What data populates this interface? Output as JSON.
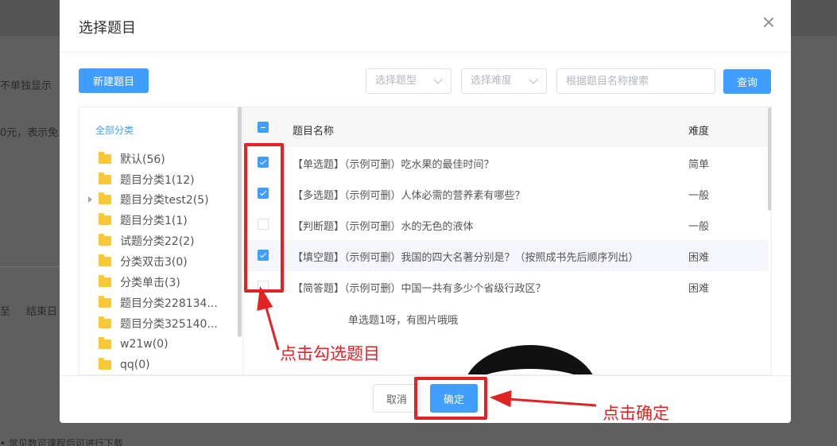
{
  "background": {
    "text_1": "不单独显示",
    "text_2": "0元，表示免",
    "text_3": "至",
    "text_4": "结束日",
    "text_5": "• 常见数可课程后可进行下载"
  },
  "modal": {
    "title": "选择题目",
    "new_button": "新建题目",
    "type_select_placeholder": "选择题型",
    "difficulty_select_placeholder": "选择难度",
    "search_placeholder": "根据题目名称搜索",
    "query_button": "查询",
    "cancel_button": "取消",
    "confirm_button": "确定"
  },
  "tree": {
    "all_label": "全部分类",
    "items": [
      {
        "label": "默认(56)"
      },
      {
        "label": "题目分类1(12)"
      },
      {
        "label": "题目分类test2(5)",
        "expandable": true
      },
      {
        "label": "题目分类1(1)"
      },
      {
        "label": "试题分类22(2)"
      },
      {
        "label": "分类双击3(0)"
      },
      {
        "label": "分类单击(3)"
      },
      {
        "label": "题目分类228134..."
      },
      {
        "label": "题目分类325140..."
      },
      {
        "label": "w21w(0)"
      },
      {
        "label": "qq(0)"
      }
    ]
  },
  "table": {
    "header": {
      "name": "题目名称",
      "difficulty": "难度"
    },
    "rows": [
      {
        "name": "【单选题】（示例可删）吃水果的最佳时间？",
        "difficulty": "简单",
        "checked": true
      },
      {
        "name": "【多选题】（示例可删）人体必需的营养素有哪些？",
        "difficulty": "一般",
        "checked": true
      },
      {
        "name": "【判断题】（示例可删）水的无色的液体",
        "difficulty": "一般",
        "checked": false
      },
      {
        "name": "【填空题】（示例可删）我国的四大名著分别是？（按照成书先后顺序列出）",
        "difficulty": "困难",
        "checked": true
      },
      {
        "name": "【简答题】（示例可删）中国一共有多少个省级行政区？",
        "difficulty": "困难",
        "checked": false
      }
    ],
    "extra_text": "单选题1呀，有图片哦哦"
  },
  "annotations": {
    "check_hint": "点击勾选题目",
    "confirm_hint": "点击确定",
    "color": "#e02424"
  },
  "colors": {
    "primary": "#409eff",
    "folder": "#f7c93a"
  }
}
